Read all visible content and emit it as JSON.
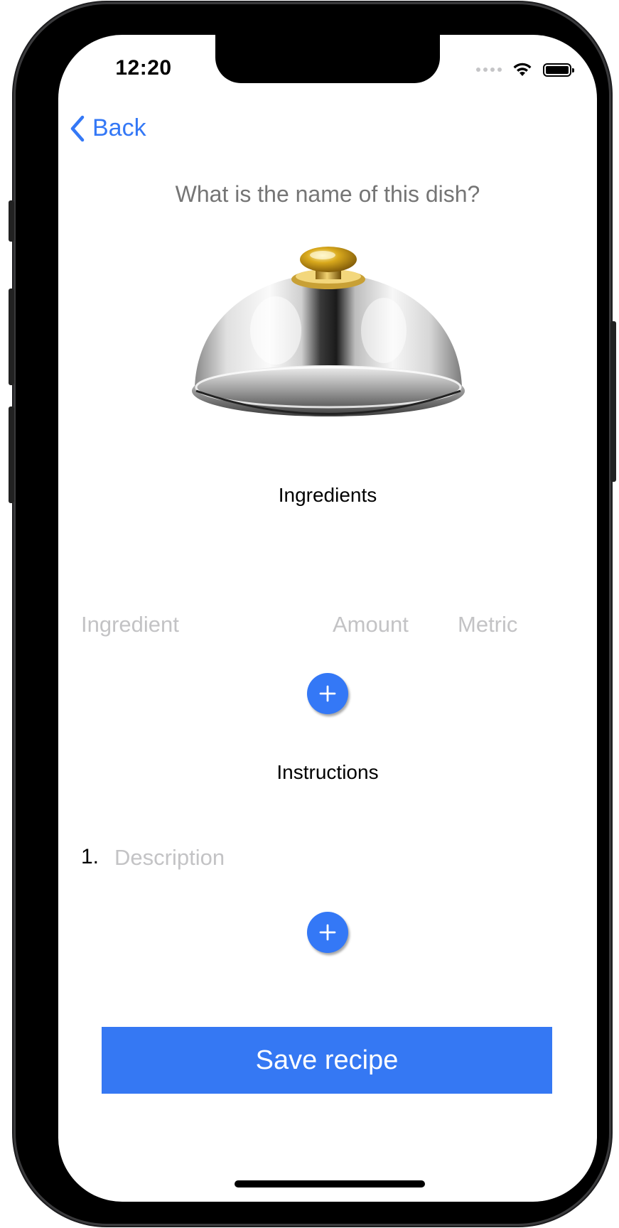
{
  "status_bar": {
    "time": "12:20"
  },
  "nav": {
    "back_label": "Back"
  },
  "dish": {
    "name_placeholder": "What is the name of this dish?"
  },
  "ingredients": {
    "title": "Ingredients",
    "ingredient_placeholder": "Ingredient",
    "amount_placeholder": "Amount",
    "metric_placeholder": "Metric"
  },
  "instructions": {
    "title": "Instructions",
    "steps": [
      {
        "number": "1.",
        "description_placeholder": "Description"
      }
    ]
  },
  "actions": {
    "save_label": "Save recipe"
  },
  "icons": {
    "back": "chevron-left-icon",
    "add": "plus-icon",
    "dish_image": "serving-cloche-image"
  },
  "colors": {
    "accent": "#3478f6",
    "placeholder": "#c3c3c5",
    "save_button": "#3578f3"
  }
}
